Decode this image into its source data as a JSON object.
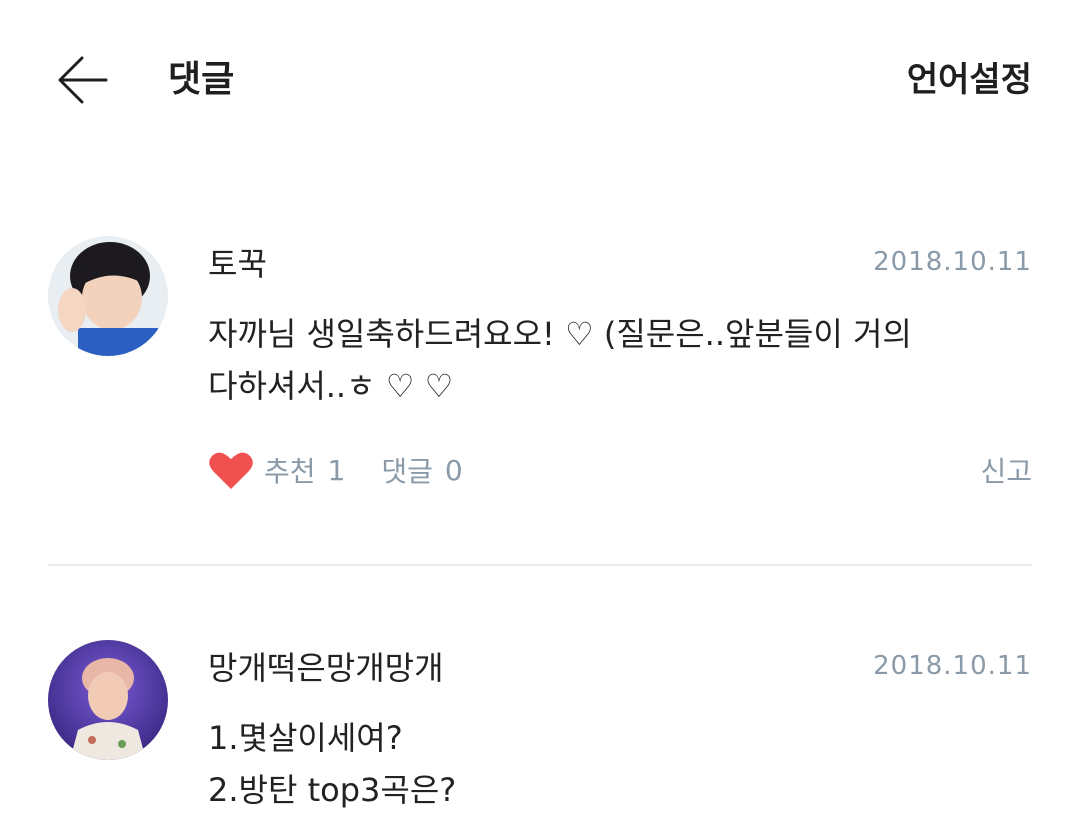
{
  "header": {
    "title": "댓글",
    "language_button": "언어설정",
    "back_icon": "arrow-left-icon"
  },
  "comments": [
    {
      "author": "토꾹",
      "date": "2018.10.11",
      "lines": [
        "자까님 생일축하드려요오! ♡ (질문은..앞분들이 거의",
        "다하셔서..ㅎ ♡ ♡"
      ],
      "like_label": "추천",
      "like_count": "1",
      "reply_label": "댓글",
      "reply_count": "0",
      "report_label": "신고",
      "heart_color": "#f05050"
    },
    {
      "author": "망개떡은망개망개",
      "date": "2018.10.11",
      "lines": [
        "1.몇살이세여?",
        "2.방탄 top3곡은?"
      ]
    }
  ],
  "colors": {
    "muted_text": "#8a9aa8",
    "divider": "#e6ecef",
    "heart": "#f05050"
  }
}
